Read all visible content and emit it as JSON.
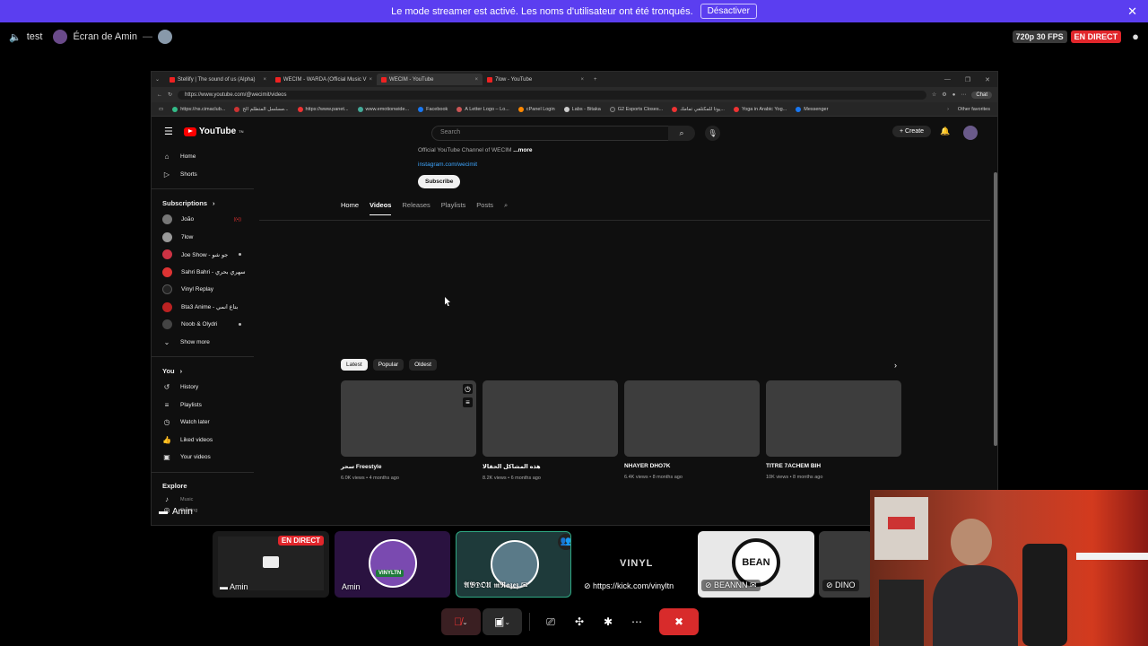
{
  "banner": {
    "message": "Le mode streamer est activé. Les noms d'utilisateur ont été tronqués.",
    "button": "Désactiver"
  },
  "call": {
    "channel": "test",
    "screen_owner": "Écran de Amin",
    "quality": "720p 30 FPS",
    "live": "EN DIRECT"
  },
  "browser": {
    "tabs": [
      "Stellify | The sound of us (Alpha)",
      "WECIM - WARDA (Official Music V",
      "WECIM - YouTube",
      "7low - YouTube"
    ],
    "url": "https://www.youtube.com/@wecimit/videos",
    "chat": "Chat",
    "bookmarks": [
      "https://ns.cimaclub...",
      "مسلسل المتطلم الح...",
      "https://www.panet...",
      "www.emotionwide...",
      "Facebook",
      "A Letter Logo – Lo...",
      "cPanel Login",
      "Labs - Bitaka",
      "G2 Esports Closes...",
      "يوتا للمكتلفي تمامك...",
      "Yoga in Arabic Yog...",
      "Messenger"
    ],
    "other_favorites": "Other favorites"
  },
  "youtube": {
    "logo": "YouTube",
    "logo_sup": "TN",
    "search_placeholder": "Search",
    "create": "Create",
    "nav": [
      "Home",
      "Shorts"
    ],
    "subscriptions_header": "Subscriptions",
    "subscriptions": [
      "João",
      "7low",
      "Joe Show - جو شو",
      "Sahri Bahri - سهري بحري",
      "Vinyl Replay",
      "Bta3 Anime - بتاع انمي",
      "Noob & Olydri"
    ],
    "show_more": "Show more",
    "you_header": "You",
    "you_items": [
      "History",
      "Playlists",
      "Watch later",
      "Liked videos",
      "Your videos"
    ],
    "explore_header": "Explore",
    "explore_items": [
      "Music",
      "Gaming"
    ],
    "channel_desc": "Official YouTube Channel of WECIM",
    "more": "...more",
    "link": "instagram.com/wecimit",
    "subscribe": "Subscribe",
    "channel_tabs": [
      "Home",
      "Videos",
      "Releases",
      "Playlists",
      "Posts"
    ],
    "chips": [
      "Latest",
      "Popular",
      "Oldest"
    ],
    "videos": [
      {
        "title": "سحر Freestyle",
        "meta": "6.0K views • 4 months ago"
      },
      {
        "title": "هذه المشاكل الحقالا",
        "meta": "8.2K views • 6 months ago"
      },
      {
        "title": "NHAYER DHO7K",
        "meta": "6.4K views • 8 months ago"
      },
      {
        "title": "TITRE 7ACHEM BIH",
        "meta": "10K views • 8 months ago"
      }
    ]
  },
  "overlay_name": "Amin",
  "participants": [
    {
      "name": "Amin",
      "badge": "EN DIRECT"
    },
    {
      "name": "Amin",
      "badge": "VINYLTN"
    },
    {
      "name": "𝕬𝕭𝕯𝕺𝖀 𝖒𝕽𝖆𝖟𝖊𝖟 ✉"
    },
    {
      "name": "https://kick.com/vinyltn",
      "logo": "VINYL"
    },
    {
      "name": "BEANNN ✉",
      "logo": "BEAN"
    },
    {
      "name": "DINO"
    }
  ],
  "colors": {
    "banner": "#5b3ef0",
    "live": "#e1262b",
    "hangup": "#d82b2b",
    "youtube_red": "#ff0000"
  }
}
